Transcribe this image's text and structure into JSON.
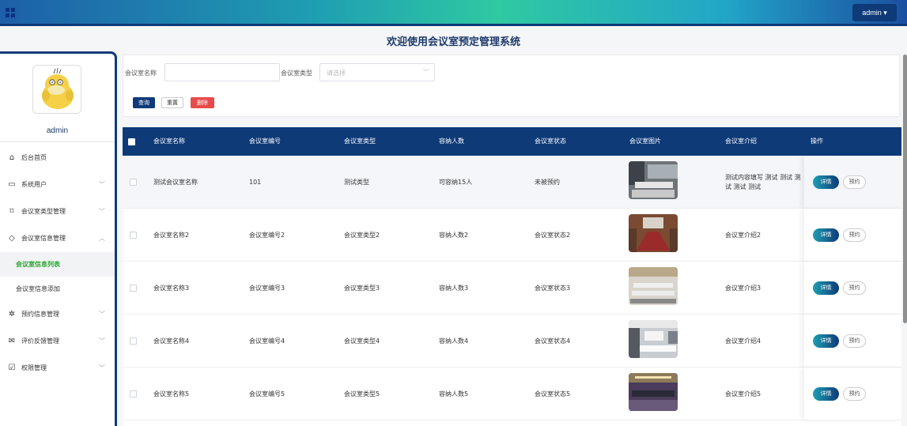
{
  "header": {
    "user_button": "admin ▾"
  },
  "page_title": "欢迎使用会议室预定管理系统",
  "sidebar": {
    "username": "admin",
    "items": [
      {
        "label": "后台首页",
        "icon": "home-icon",
        "glyph": "⌂",
        "has_children": false
      },
      {
        "label": "系统用户",
        "icon": "monitor-icon",
        "glyph": "▭",
        "has_children": true
      },
      {
        "label": "会议室类型管理",
        "icon": "bookmark-icon",
        "glyph": "⌑",
        "has_children": true
      },
      {
        "label": "会议室信息管理",
        "icon": "tag-icon",
        "glyph": "◇",
        "has_children": true,
        "expanded": true
      },
      {
        "label": "会议室信息列表",
        "sub": true,
        "active": true
      },
      {
        "label": "会议室信息添加",
        "sub": true
      },
      {
        "label": "预约信息管理",
        "icon": "gear-icon",
        "glyph": "✲",
        "has_children": true
      },
      {
        "label": "评价反馈管理",
        "icon": "mail-icon",
        "glyph": "✉",
        "has_children": true
      },
      {
        "label": "权限管理",
        "icon": "clipboard-icon",
        "glyph": "☑",
        "has_children": true
      }
    ]
  },
  "search": {
    "name_label": "会议室名称",
    "name_value": "",
    "type_label": "会议室类型",
    "type_placeholder": "请选择",
    "query_button": "查询",
    "reset_button": "重置",
    "delete_button": "删除"
  },
  "table": {
    "columns": [
      "会议室名称",
      "会议室编号",
      "会议室类型",
      "容纳人数",
      "会议室状态",
      "会议室图片",
      "会议室介绍",
      "操作"
    ],
    "rows": [
      {
        "name": "测试会议室名称",
        "code": "101",
        "type": "测试类型",
        "capacity": "可容纳15人",
        "status": "未被预约",
        "intro": "测试内容填写 测试 测试 测试 测试 测试"
      },
      {
        "name": "会议室名称2",
        "code": "会议室编号2",
        "type": "会议室类型2",
        "capacity": "容纳人数2",
        "status": "会议室状态2",
        "intro": "会议室介绍2"
      },
      {
        "name": "会议室名称3",
        "code": "会议室编号3",
        "type": "会议室类型3",
        "capacity": "容纳人数3",
        "status": "会议室状态3",
        "intro": "会议室介绍3"
      },
      {
        "name": "会议室名称4",
        "code": "会议室编号4",
        "type": "会议室类型4",
        "capacity": "容纳人数4",
        "status": "会议室状态4",
        "intro": "会议室介绍4"
      },
      {
        "name": "会议室名称5",
        "code": "会议室编号5",
        "type": "会议室类型5",
        "capacity": "容纳人数5",
        "status": "会议室状态5",
        "intro": "会议室介绍5"
      }
    ],
    "detail_button": "详情",
    "book_button": "预约"
  }
}
